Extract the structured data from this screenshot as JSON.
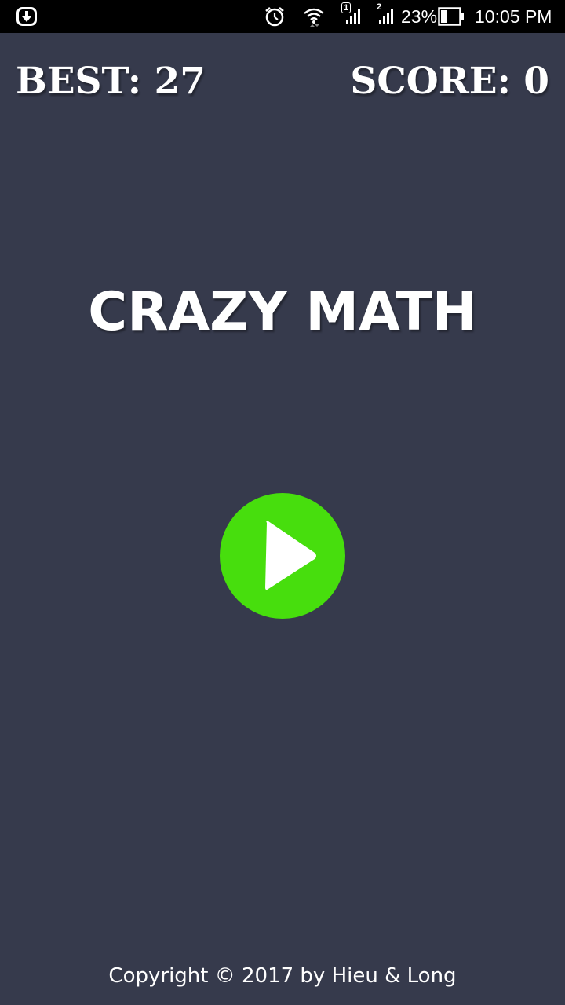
{
  "status_bar": {
    "sim1_label": "1",
    "sim2_label": "2",
    "battery_percent": "23%",
    "time": "10:05 PM",
    "icons": [
      "download-notification-icon",
      "alarm-icon",
      "wifi-icon",
      "signal-icon",
      "battery-icon"
    ]
  },
  "game": {
    "best_label": "BEST: 27",
    "score_label": "SCORE: 0",
    "title": "CRAZY MATH",
    "play_icon": "play-icon",
    "play_button_color": "#47de0d",
    "background_color": "#363a4c"
  },
  "footer": {
    "copyright": "Copyright © 2017 by Hieu & Long"
  }
}
